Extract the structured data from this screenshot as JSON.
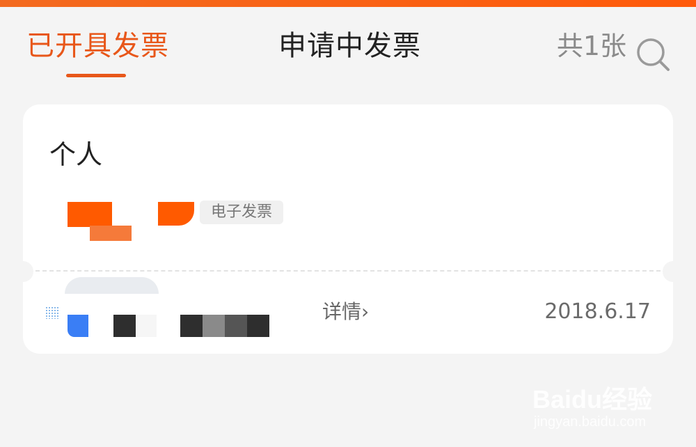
{
  "tabs": {
    "issued": "已开具发票",
    "applying": "申请中发票"
  },
  "count_label": "共1张",
  "icons": {
    "search": "search-icon",
    "chevron": "chevron-right-icon"
  },
  "colors": {
    "accent": "#e8571a",
    "top_bar": "#ff5a0a",
    "background": "#f4f4f4"
  },
  "invoice": {
    "title": "个人",
    "type": "电子发票",
    "detail_label": "详情",
    "chevron": "›",
    "date": "2018.6.17"
  },
  "watermark": {
    "logo": "Baidu经验",
    "url": "jingyan.baidu.com"
  }
}
